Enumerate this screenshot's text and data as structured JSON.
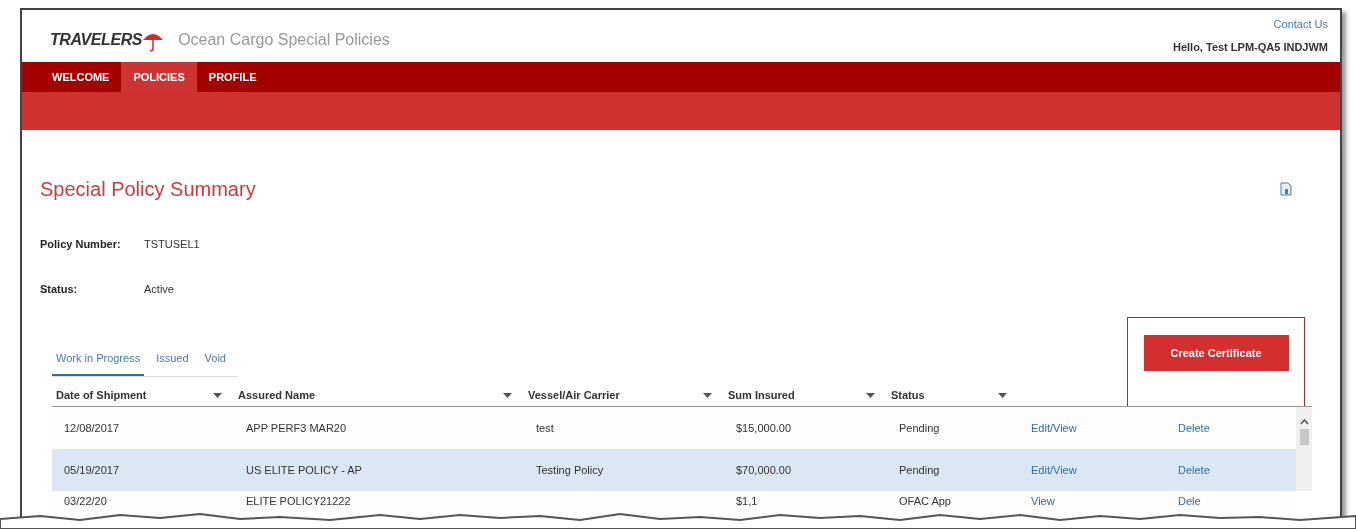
{
  "header": {
    "logo": "TRAVELERS",
    "app_title": "Ocean Cargo Special Policies",
    "contact_link": "Contact Us",
    "greeting": "Hello, Test LPM-QA5 INDJWM"
  },
  "nav": [
    {
      "label": "WELCOME",
      "selected": false
    },
    {
      "label": "POLICIES",
      "selected": true
    },
    {
      "label": "PROFILE",
      "selected": false
    }
  ],
  "page_title": "Special Policy Summary",
  "fields": [
    {
      "label": "Policy Number:",
      "value": "TSTUSEL1"
    },
    {
      "label": "Status:",
      "value": "Active"
    }
  ],
  "tabs": [
    {
      "label": "Work in Progress",
      "selected": true
    },
    {
      "label": "Issued",
      "selected": false
    },
    {
      "label": "Void",
      "selected": false
    }
  ],
  "create_button": "Create Certificate",
  "table": {
    "columns": [
      "Date of Shipment",
      "Assured Name",
      "Vessel/Air Carrier",
      "Sum Insured",
      "Status"
    ],
    "rows": [
      {
        "selected": false,
        "cells": [
          "12/08/2017",
          "APP PERF3 MAR20",
          "test",
          "$15,000.00",
          "Pending"
        ],
        "edit": "Edit/View",
        "delete": "Delete"
      },
      {
        "selected": true,
        "cells": [
          "05/19/2017",
          "US ELITE POLICY - AP",
          "Testing Policy",
          "$70,000.00",
          "Pending"
        ],
        "edit": "Edit/View",
        "delete": "Delete"
      },
      {
        "selected": false,
        "cells": [
          "03/22/20",
          "ELITE POLICY21222",
          "",
          "$1,1",
          "OFAC App"
        ],
        "edit": "View",
        "delete": "Dele"
      }
    ]
  }
}
